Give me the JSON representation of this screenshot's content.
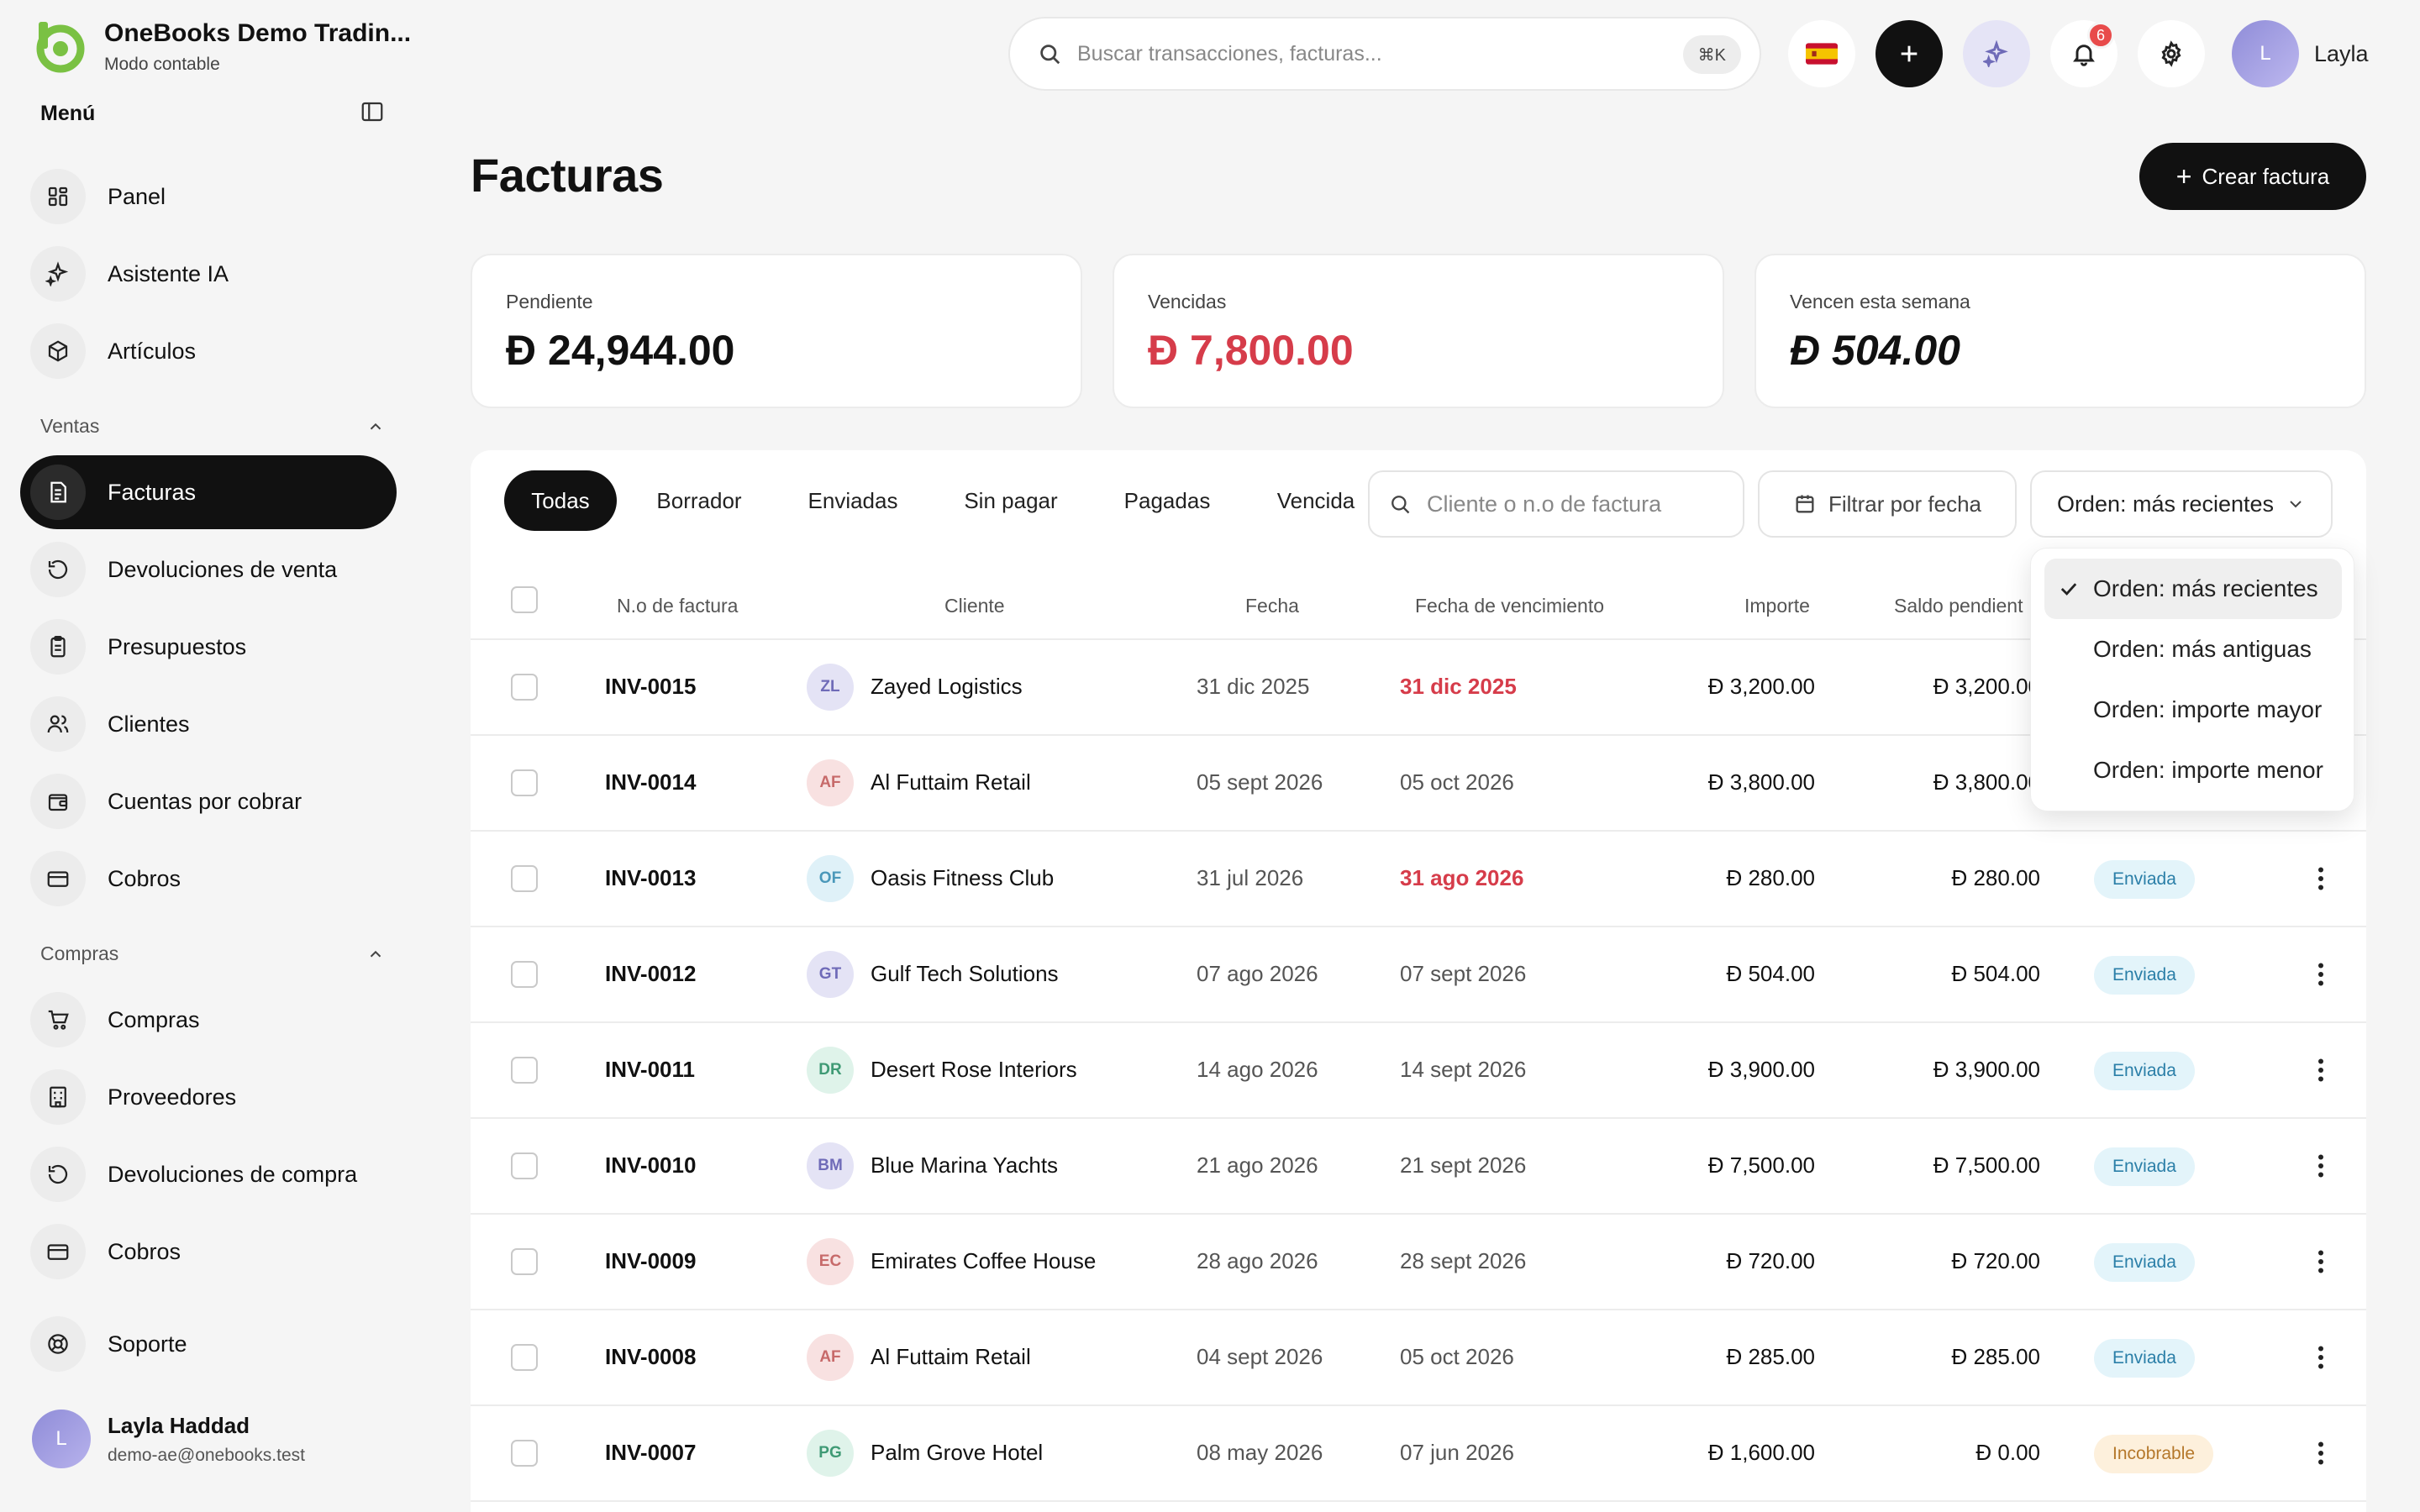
{
  "app": {
    "name": "OneBooks Demo Tradin...",
    "mode": "Modo contable"
  },
  "sidebar": {
    "menu_title": "Menú",
    "items_top": [
      {
        "label": "Panel",
        "icon": "dashboard-icon"
      },
      {
        "label": "Asistente IA",
        "icon": "sparkle-icon"
      },
      {
        "label": "Artículos",
        "icon": "box-icon"
      }
    ],
    "sales_title": "Ventas",
    "sales_items": [
      {
        "label": "Facturas",
        "icon": "invoice-icon",
        "active": true
      },
      {
        "label": "Devoluciones de venta",
        "icon": "return-icon"
      },
      {
        "label": "Presupuestos",
        "icon": "clipboard-icon"
      },
      {
        "label": "Clientes",
        "icon": "users-icon"
      },
      {
        "label": "Cuentas por cobrar",
        "icon": "wallet-icon"
      },
      {
        "label": "Cobros",
        "icon": "card-icon"
      }
    ],
    "purchases_title": "Compras",
    "purchase_items": [
      {
        "label": "Compras",
        "icon": "cart-icon"
      },
      {
        "label": "Proveedores",
        "icon": "building-icon"
      },
      {
        "label": "Devoluciones de compra",
        "icon": "return-icon"
      },
      {
        "label": "Cobros",
        "icon": "card-icon"
      }
    ],
    "support": {
      "label": "Soporte",
      "icon": "lifebuoy-icon"
    },
    "user": {
      "initial": "L",
      "name": "Layla Haddad",
      "email": "demo-ae@onebooks.test"
    }
  },
  "topbar": {
    "search_placeholder": "Buscar transacciones, facturas...",
    "shortcut": "⌘K",
    "notifications_count": "6",
    "user_initial": "L",
    "user_name": "Layla"
  },
  "page": {
    "title": "Facturas",
    "create_button": "Crear factura"
  },
  "currency_symbol": "Ð",
  "stats": [
    {
      "label": "Pendiente",
      "value": "24,944.00"
    },
    {
      "label": "Vencidas",
      "value": "7,800.00"
    },
    {
      "label": "Vencen esta semana",
      "value": "504.00"
    }
  ],
  "tabs": [
    "Todas",
    "Borrador",
    "Enviadas",
    "Sin pagar",
    "Pagadas",
    "Vencida"
  ],
  "filters": {
    "client_placeholder": "Cliente o n.o de factura",
    "date_filter": "Filtrar por fecha",
    "sort_label": "Orden: más recientes"
  },
  "sort_options": [
    {
      "label": "Orden: más recientes",
      "selected": true
    },
    {
      "label": "Orden: más antiguas"
    },
    {
      "label": "Orden: importe mayor"
    },
    {
      "label": "Orden: importe menor"
    }
  ],
  "columns": [
    "N.o de factura",
    "Cliente",
    "Fecha",
    "Fecha de vencimiento",
    "Importe",
    "Saldo pendient"
  ],
  "rows": [
    {
      "inv": "INV-0015",
      "initials": "ZL",
      "client": "Zayed Logistics",
      "date": "31 dic 2025",
      "due": "31 dic 2025",
      "overdue": true,
      "amount": "3,200.00",
      "balance": "3,200.00",
      "status": "",
      "av_bg": "#e4e3f5",
      "av_fg": "#6f6bb8"
    },
    {
      "inv": "INV-0014",
      "initials": "AF",
      "client": "Al Futtaim Retail",
      "date": "05 sept 2026",
      "due": "05 oct 2026",
      "overdue": false,
      "amount": "3,800.00",
      "balance": "3,800.00",
      "status": "",
      "av_bg": "#f8e1e1",
      "av_fg": "#c76a6a"
    },
    {
      "inv": "INV-0013",
      "initials": "OF",
      "client": "Oasis Fitness Club",
      "date": "31 jul 2026",
      "due": "31 ago 2026",
      "overdue": true,
      "amount": "280.00",
      "balance": "280.00",
      "status": "Enviada",
      "av_bg": "#dff1f8",
      "av_fg": "#4a98ba"
    },
    {
      "inv": "INV-0012",
      "initials": "GT",
      "client": "Gulf Tech Solutions",
      "date": "07 ago 2026",
      "due": "07 sept 2026",
      "overdue": false,
      "amount": "504.00",
      "balance": "504.00",
      "status": "Enviada",
      "av_bg": "#e4e3f5",
      "av_fg": "#6f6bb8"
    },
    {
      "inv": "INV-0011",
      "initials": "DR",
      "client": "Desert Rose Interiors",
      "date": "14 ago 2026",
      "due": "14 sept 2026",
      "overdue": false,
      "amount": "3,900.00",
      "balance": "3,900.00",
      "status": "Enviada",
      "av_bg": "#dff3ea",
      "av_fg": "#3f9a75"
    },
    {
      "inv": "INV-0010",
      "initials": "BM",
      "client": "Blue Marina Yachts",
      "date": "21 ago 2026",
      "due": "21 sept 2026",
      "overdue": false,
      "amount": "7,500.00",
      "balance": "7,500.00",
      "status": "Enviada",
      "av_bg": "#e4e3f5",
      "av_fg": "#6f6bb8"
    },
    {
      "inv": "INV-0009",
      "initials": "EC",
      "client": "Emirates Coffee House",
      "date": "28 ago 2026",
      "due": "28 sept 2026",
      "overdue": false,
      "amount": "720.00",
      "balance": "720.00",
      "status": "Enviada",
      "av_bg": "#f8e1e1",
      "av_fg": "#c76a6a"
    },
    {
      "inv": "INV-0008",
      "initials": "AF",
      "client": "Al Futtaim Retail",
      "date": "04 sept 2026",
      "due": "05 oct 2026",
      "overdue": false,
      "amount": "285.00",
      "balance": "285.00",
      "status": "Enviada",
      "av_bg": "#f8e1e1",
      "av_fg": "#c76a6a"
    },
    {
      "inv": "INV-0007",
      "initials": "PG",
      "client": "Palm Grove Hotel",
      "date": "08 may 2026",
      "due": "07 jun 2026",
      "overdue": false,
      "amount": "1,600.00",
      "balance": "0.00",
      "status": "Incobrable",
      "av_bg": "#dff3ea",
      "av_fg": "#3f9a75"
    }
  ],
  "colors": {
    "accent": "#111111",
    "brand_green": "#7ac143",
    "danger": "#d63c4a",
    "status_sent_bg": "#e3f4fa",
    "status_bad_bg": "#fdf0dc"
  }
}
